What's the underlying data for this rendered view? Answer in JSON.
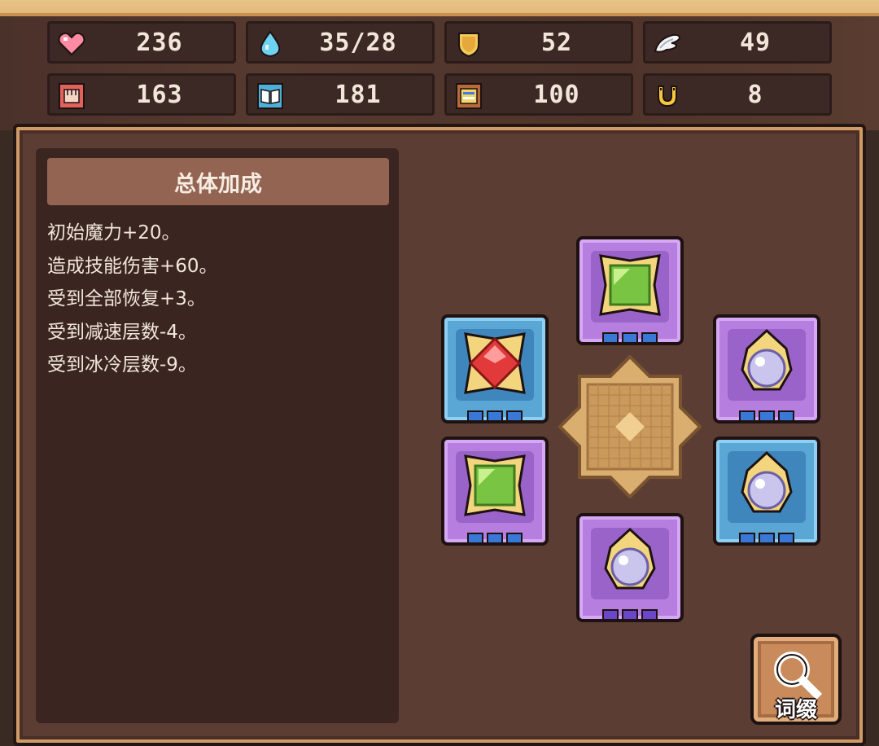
{
  "stats_row1": [
    {
      "icon": "heart-icon",
      "value": "236"
    },
    {
      "icon": "mana-drop-icon",
      "value": "35/28"
    },
    {
      "icon": "shield-icon",
      "value": "52"
    },
    {
      "icon": "wing-icon",
      "value": "49"
    }
  ],
  "stats_row2": [
    {
      "icon": "fist-icon",
      "value": "163"
    },
    {
      "icon": "book-icon",
      "value": "181"
    },
    {
      "icon": "scroll-icon",
      "value": "100"
    },
    {
      "icon": "horseshoe-icon",
      "value": "8"
    }
  ],
  "bonus_panel": {
    "title": "总体加成",
    "lines": [
      "初始魔力+20。",
      "造成技能伤害+60。",
      "受到全部恢复+3。",
      "受到减速层数-4。",
      "受到冰冷层数-9。"
    ]
  },
  "gem_slots": [
    {
      "name": "top",
      "frame": "purple",
      "gem": "green-square-gem"
    },
    {
      "name": "left-upper",
      "frame": "blue",
      "gem": "red-square-gem"
    },
    {
      "name": "right-upper",
      "frame": "purple",
      "gem": "white-round-gem"
    },
    {
      "name": "left-lower",
      "frame": "purple",
      "gem": "green-square-gem"
    },
    {
      "name": "right-lower",
      "frame": "blue",
      "gem": "white-round-gem"
    },
    {
      "name": "bottom",
      "frame": "purple",
      "gem": "white-round-gem"
    }
  ],
  "affix_button": {
    "label": "词缀",
    "icon": "magnifier-icon"
  }
}
